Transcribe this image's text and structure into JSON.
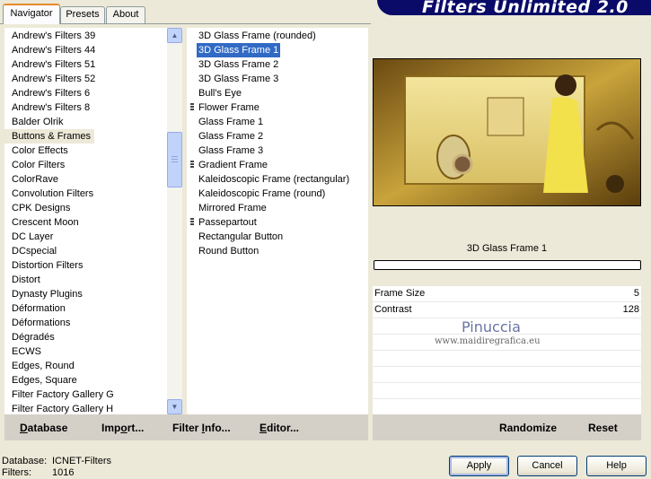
{
  "tabs": [
    {
      "label": "Navigator",
      "active": true
    },
    {
      "label": "Presets",
      "active": false
    },
    {
      "label": "About",
      "active": false
    }
  ],
  "banner": {
    "title": "Filters Unlimited 2.0"
  },
  "categories": [
    "Andrew's Filters 39",
    "Andrew's Filters 44",
    "Andrew's Filters 51",
    "Andrew's Filters 52",
    "Andrew's Filters 6",
    "Andrew's Filters 8",
    "Balder Olrik",
    "Buttons & Frames",
    "Color Effects",
    "Color Filters",
    "ColorRave",
    "Convolution Filters",
    "CPK Designs",
    "Crescent Moon",
    "DC Layer",
    "DCspecial",
    "Distortion Filters",
    "Distort",
    "Dynasty Plugins",
    "Déformation",
    "Déformations",
    "Dégradés",
    "ECWS",
    "Edges, Round",
    "Edges, Square",
    "Filter Factory Gallery G",
    "Filter Factory Gallery H"
  ],
  "selected_category_index": 7,
  "filters": [
    {
      "label": "3D Glass Frame (rounded)",
      "marker": false
    },
    {
      "label": "3D Glass Frame 1",
      "marker": false
    },
    {
      "label": "3D Glass Frame 2",
      "marker": false
    },
    {
      "label": "3D Glass Frame 3",
      "marker": false
    },
    {
      "label": "Bull's Eye",
      "marker": false
    },
    {
      "label": "Flower Frame",
      "marker": true
    },
    {
      "label": "Glass Frame 1",
      "marker": false
    },
    {
      "label": "Glass Frame 2",
      "marker": false
    },
    {
      "label": "Glass Frame 3",
      "marker": false
    },
    {
      "label": "Gradient Frame",
      "marker": true
    },
    {
      "label": "Kaleidoscopic Frame (rectangular)",
      "marker": false
    },
    {
      "label": "Kaleidoscopic Frame (round)",
      "marker": false
    },
    {
      "label": "Mirrored Frame",
      "marker": false
    },
    {
      "label": "Passepartout",
      "marker": true
    },
    {
      "label": "Rectangular Button",
      "marker": false
    },
    {
      "label": "Round Button",
      "marker": false
    }
  ],
  "selected_filter_index": 1,
  "left_buttons": {
    "database": {
      "u": "D",
      "rest": "atabase"
    },
    "import": {
      "pre": "Imp",
      "u": "o",
      "rest": "rt..."
    },
    "filter_info": {
      "pre": "Filter ",
      "u": "I",
      "rest": "nfo..."
    },
    "editor": {
      "u": "E",
      "rest": "ditor..."
    }
  },
  "preview": {
    "filter_name": "3D Glass Frame 1"
  },
  "params": [
    {
      "label": "Frame Size",
      "value": "5"
    },
    {
      "label": "Contrast",
      "value": "128"
    }
  ],
  "watermark": {
    "line1": "Pinuccia",
    "line2": "www.maidiregrafica.eu"
  },
  "right_buttons": {
    "randomize": "Randomize",
    "reset": "Reset"
  },
  "status": {
    "database_label": "Database:",
    "database_value": "ICNET-Filters",
    "filters_label": "Filters:",
    "filters_value": "1016"
  },
  "dialog_buttons": {
    "apply": "Apply",
    "cancel": "Cancel",
    "help": "Help"
  },
  "colors": {
    "selection_blue": "#316ac5",
    "banner": "#0a0a68",
    "tab_accent": "#e68b2c"
  }
}
